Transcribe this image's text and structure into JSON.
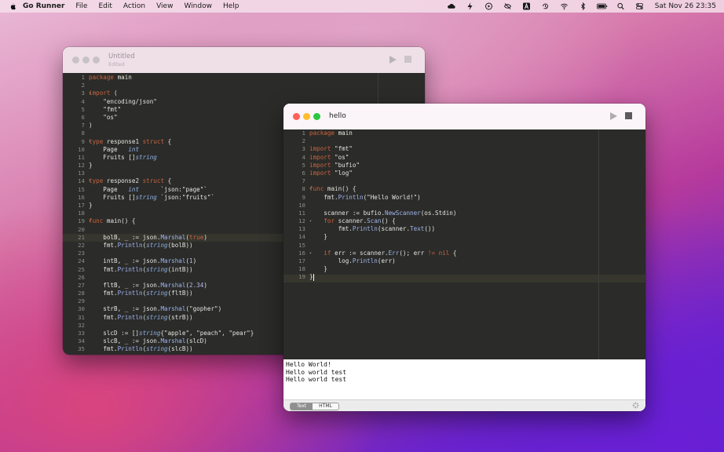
{
  "menubar": {
    "app_name": "Go Runner",
    "menus": [
      "File",
      "Edit",
      "Action",
      "View",
      "Window",
      "Help"
    ],
    "clock": "Sat Nov 26  23:35",
    "status_icons": [
      "creative-cloud-icon",
      "bolt-icon",
      "play-circle-icon",
      "eye-slash-icon",
      "input-source-icon",
      "time-machine-icon",
      "wifi-icon",
      "bluetooth-icon",
      "battery-icon",
      "search-icon",
      "control-center-icon"
    ]
  },
  "window_untitled": {
    "title": "Untitled",
    "subtitle": "Edited",
    "line_numbers": [
      "1",
      "2",
      "3",
      "4",
      "5",
      "6",
      "7",
      "8",
      "9",
      "10",
      "11",
      "12",
      "13",
      "14",
      "15",
      "16",
      "17",
      "18",
      "19",
      "20",
      "21",
      "22",
      "23",
      "24",
      "25",
      "26",
      "27",
      "28",
      "29",
      "30",
      "31",
      "32",
      "33",
      "34",
      "35"
    ],
    "code": [
      [
        [
          "kw",
          "package"
        ],
        [
          "t",
          " main"
        ]
      ],
      [],
      [
        [
          "kw",
          "import"
        ],
        [
          "t",
          " ("
        ]
      ],
      [
        [
          "t",
          "    \"encoding/json\""
        ]
      ],
      [
        [
          "t",
          "    \"fmt\""
        ]
      ],
      [
        [
          "t",
          "    \"os\""
        ]
      ],
      [
        [
          "t",
          ")"
        ]
      ],
      [],
      [
        [
          "kw",
          "type"
        ],
        [
          "t",
          " response1 "
        ],
        [
          "kw",
          "struct"
        ],
        [
          "t",
          " {"
        ]
      ],
      [
        [
          "t",
          "    Page   "
        ],
        [
          "typ",
          "int"
        ]
      ],
      [
        [
          "t",
          "    Fruits []"
        ],
        [
          "typ",
          "string"
        ]
      ],
      [
        [
          "t",
          "}"
        ]
      ],
      [],
      [
        [
          "kw",
          "type"
        ],
        [
          "t",
          " response2 "
        ],
        [
          "kw",
          "struct"
        ],
        [
          "t",
          " {"
        ]
      ],
      [
        [
          "t",
          "    Page   "
        ],
        [
          "typ",
          "int"
        ],
        [
          "t",
          "      `json:\"page\"`"
        ]
      ],
      [
        [
          "t",
          "    Fruits []"
        ],
        [
          "typ",
          "string"
        ],
        [
          "t",
          " `json:\"fruits\"`"
        ]
      ],
      [
        [
          "t",
          "}"
        ]
      ],
      [],
      [
        [
          "kw",
          "func"
        ],
        [
          "t",
          " main() {"
        ]
      ],
      [],
      [
        [
          "t",
          "    bolB, _ := json."
        ],
        [
          "fn",
          "Marshal"
        ],
        [
          "t",
          "("
        ],
        [
          "kw",
          "true"
        ],
        [
          "t",
          ")"
        ]
      ],
      [
        [
          "t",
          "    fmt."
        ],
        [
          "fn",
          "Println"
        ],
        [
          "t",
          "("
        ],
        [
          "typ",
          "string"
        ],
        [
          "t",
          "(bolB))"
        ]
      ],
      [],
      [
        [
          "t",
          "    intB, _ := json."
        ],
        [
          "fn",
          "Marshal"
        ],
        [
          "t",
          "("
        ],
        [
          "num",
          "1"
        ],
        [
          "t",
          ")"
        ]
      ],
      [
        [
          "t",
          "    fmt."
        ],
        [
          "fn",
          "Println"
        ],
        [
          "t",
          "("
        ],
        [
          "typ",
          "string"
        ],
        [
          "t",
          "(intB))"
        ]
      ],
      [],
      [
        [
          "t",
          "    fltB, _ := json."
        ],
        [
          "fn",
          "Marshal"
        ],
        [
          "t",
          "("
        ],
        [
          "num",
          "2.34"
        ],
        [
          "t",
          ")"
        ]
      ],
      [
        [
          "t",
          "    fmt."
        ],
        [
          "fn",
          "Println"
        ],
        [
          "t",
          "("
        ],
        [
          "typ",
          "string"
        ],
        [
          "t",
          "(fltB))"
        ]
      ],
      [],
      [
        [
          "t",
          "    strB, _ := json."
        ],
        [
          "fn",
          "Marshal"
        ],
        [
          "t",
          "(\"gopher\")"
        ]
      ],
      [
        [
          "t",
          "    fmt."
        ],
        [
          "fn",
          "Println"
        ],
        [
          "t",
          "("
        ],
        [
          "typ",
          "string"
        ],
        [
          "t",
          "(strB))"
        ]
      ],
      [],
      [
        [
          "t",
          "    slcD := []"
        ],
        [
          "typ",
          "string"
        ],
        [
          "t",
          "{\"apple\", \"peach\", \"pear\"}"
        ]
      ],
      [
        [
          "t",
          "    slcB, _ := json."
        ],
        [
          "fn",
          "Marshal"
        ],
        [
          "t",
          "(slcD)"
        ]
      ],
      [
        [
          "t",
          "    fmt."
        ],
        [
          "fn",
          "Println"
        ],
        [
          "t",
          "("
        ],
        [
          "typ",
          "string"
        ],
        [
          "t",
          "(slcB))"
        ]
      ]
    ]
  },
  "window_hello": {
    "title": "hello",
    "line_numbers": [
      "1",
      "2",
      "3",
      "4",
      "5",
      "6",
      "7",
      "8",
      "9",
      "10",
      "11",
      "12",
      "13",
      "14",
      "15",
      "16",
      "17",
      "18",
      "19"
    ],
    "code": [
      [
        [
          "kw",
          "package"
        ],
        [
          "t",
          " main"
        ]
      ],
      [],
      [
        [
          "kw",
          "import"
        ],
        [
          "t",
          " \"fmt\""
        ]
      ],
      [
        [
          "kw",
          "import"
        ],
        [
          "t",
          " \"os\""
        ]
      ],
      [
        [
          "kw",
          "import"
        ],
        [
          "t",
          " \"bufio\""
        ]
      ],
      [
        [
          "kw",
          "import"
        ],
        [
          "t",
          " \"log\""
        ]
      ],
      [],
      [
        [
          "kw",
          "func"
        ],
        [
          "t",
          " main() {"
        ]
      ],
      [
        [
          "t",
          "    fmt."
        ],
        [
          "fn",
          "Println"
        ],
        [
          "t",
          "(\"Hello World!\")"
        ]
      ],
      [],
      [
        [
          "t",
          "    scanner := bufio."
        ],
        [
          "fn",
          "NewScanner"
        ],
        [
          "t",
          "(os.Stdin)"
        ]
      ],
      [
        [
          "t",
          "    "
        ],
        [
          "kw",
          "for"
        ],
        [
          "t",
          " scanner."
        ],
        [
          "fn",
          "Scan"
        ],
        [
          "t",
          "() {"
        ]
      ],
      [
        [
          "t",
          "        fmt."
        ],
        [
          "fn",
          "Println"
        ],
        [
          "t",
          "(scanner."
        ],
        [
          "fn",
          "Text"
        ],
        [
          "t",
          "())"
        ]
      ],
      [
        [
          "t",
          "    }"
        ]
      ],
      [],
      [
        [
          "t",
          "    "
        ],
        [
          "kw",
          "if"
        ],
        [
          "t",
          " err := scanner."
        ],
        [
          "fn",
          "Err"
        ],
        [
          "t",
          "(); err "
        ],
        [
          "kw",
          "!="
        ],
        [
          "t",
          " "
        ],
        [
          "kw",
          "nil"
        ],
        [
          "t",
          " {"
        ]
      ],
      [
        [
          "t",
          "        log."
        ],
        [
          "fn",
          "Println"
        ],
        [
          "t",
          "(err)"
        ]
      ],
      [
        [
          "t",
          "    }"
        ]
      ],
      [
        [
          "t",
          "}"
        ]
      ]
    ],
    "output_lines": [
      "Hello World!",
      "Hello world test",
      "Hello world test"
    ],
    "tabs": [
      "Text",
      "HTML"
    ],
    "active_tab": "Text"
  },
  "colors": {
    "close": "#ff5f57",
    "minimize": "#febc2e",
    "zoom": "#28c840",
    "editor_bg": "#2b2b29",
    "keyword": "#c8643c"
  }
}
